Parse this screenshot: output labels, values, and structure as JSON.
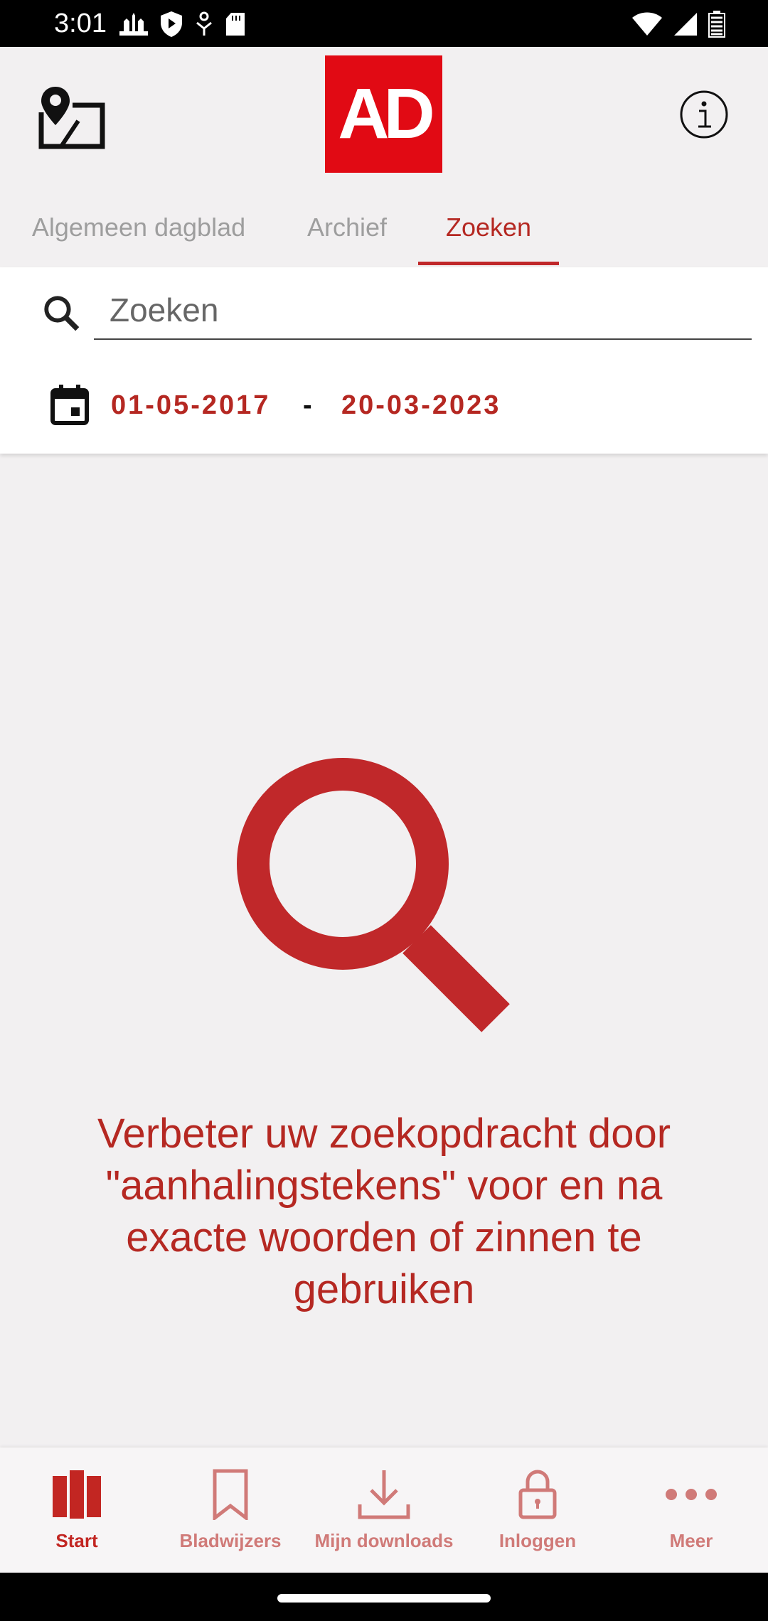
{
  "status_bar": {
    "time": "3:01"
  },
  "header": {
    "logo_text": "AD"
  },
  "tabs": [
    {
      "label": "Algemeen dagblad",
      "active": false
    },
    {
      "label": "Archief",
      "active": false
    },
    {
      "label": "Zoeken",
      "active": true
    }
  ],
  "search": {
    "placeholder": "Zoeken",
    "value": "",
    "date_from": "01-05-2017",
    "date_separator": "-",
    "date_to": "20-03-2023"
  },
  "empty_state": {
    "hint": "Verbeter uw zoekopdracht door \"aanhalingstekens\" voor en na exacte woorden of zinnen te gebruiken"
  },
  "bottom_nav": [
    {
      "label": "Start",
      "icon": "newspapers-icon",
      "active": true
    },
    {
      "label": "Bladwijzers",
      "icon": "bookmark-icon",
      "active": false
    },
    {
      "label": "Mijn downloads",
      "icon": "download-icon",
      "active": false
    },
    {
      "label": "Inloggen",
      "icon": "lock-icon",
      "active": false
    },
    {
      "label": "Meer",
      "icon": "more-icon",
      "active": false
    }
  ],
  "colors": {
    "accent": "#b52822",
    "logo_red": "#e10a14",
    "background": "#f2f0f1"
  }
}
